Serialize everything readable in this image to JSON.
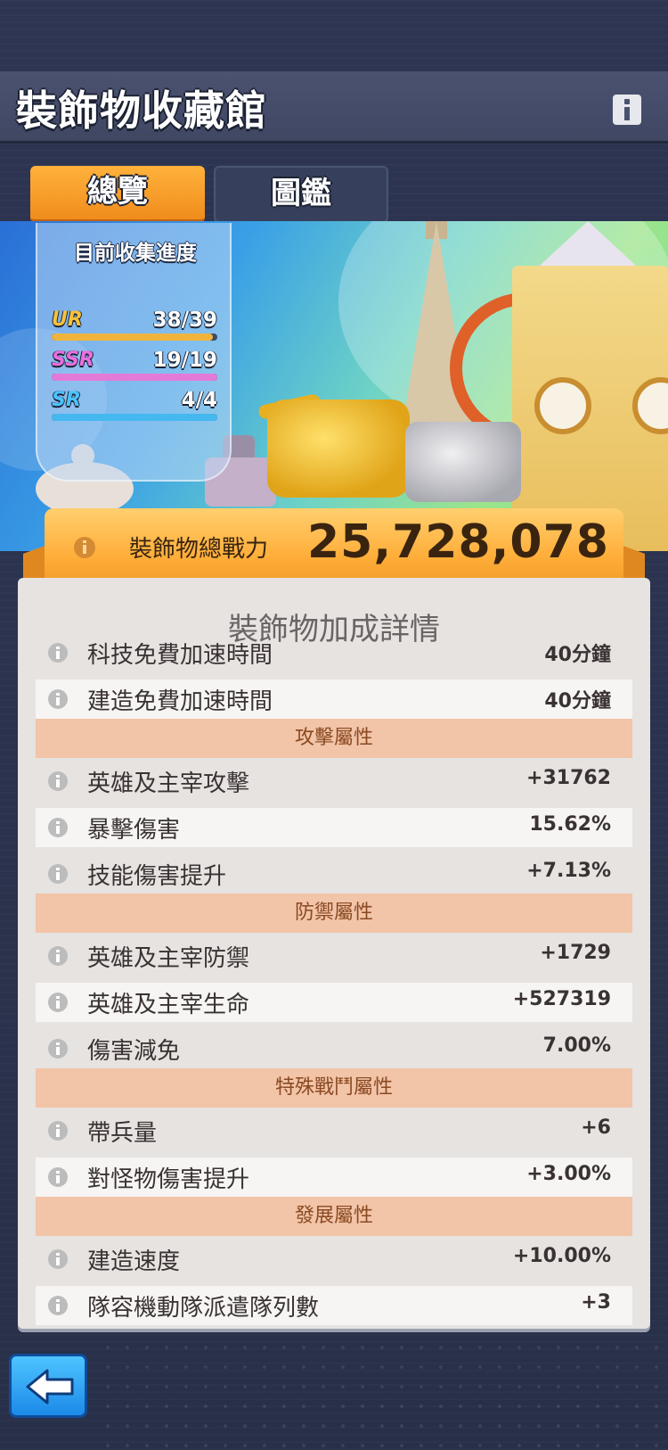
{
  "header": {
    "title": "裝飾物收藏館"
  },
  "tabs": [
    {
      "label": "總覽",
      "active": true
    },
    {
      "label": "圖鑑",
      "active": false
    }
  ],
  "progress": {
    "title": "目前收集進度",
    "items": [
      {
        "rarity": "UR",
        "count": "38/39",
        "fraction": 0.974,
        "color": "#f0b43c",
        "text_color": "#f5c23a"
      },
      {
        "rarity": "SSR",
        "count": "19/19",
        "fraction": 1.0,
        "color": "#e47ad8",
        "text_color": "#e86fe0"
      },
      {
        "rarity": "SR",
        "count": "4/4",
        "fraction": 1.0,
        "color": "#46b8f0",
        "text_color": "#4ac4ff"
      }
    ]
  },
  "power": {
    "label": "裝飾物總戰力",
    "value": "25,728,078"
  },
  "details": {
    "title": "裝飾物加成詳情",
    "rows": [
      {
        "label": "科技免費加速時間",
        "value": "40分鐘"
      },
      {
        "label": "建造免費加速時間",
        "value": "40分鐘"
      }
    ],
    "sections": [
      {
        "title": "攻擊屬性",
        "rows": [
          {
            "label": "英雄及主宰攻擊",
            "value": "+31762"
          },
          {
            "label": "暴擊傷害",
            "value": "15.62%"
          },
          {
            "label": "技能傷害提升",
            "value": "+7.13%"
          }
        ]
      },
      {
        "title": "防禦屬性",
        "rows": [
          {
            "label": "英雄及主宰防禦",
            "value": "+1729"
          },
          {
            "label": "英雄及主宰生命",
            "value": "+527319"
          },
          {
            "label": "傷害減免",
            "value": "7.00%"
          }
        ]
      },
      {
        "title": "特殊戰鬥屬性",
        "rows": [
          {
            "label": "帶兵量",
            "value": "+6"
          },
          {
            "label": "對怪物傷害提升",
            "value": "+3.00%"
          }
        ]
      },
      {
        "title": "發展屬性",
        "rows": [
          {
            "label": "建造速度",
            "value": "+10.00%"
          },
          {
            "label": "隊容機動隊派遣隊列數",
            "value": "+3"
          }
        ]
      }
    ]
  },
  "colors": {
    "accent": "#f08c1c",
    "section_bg": "#f2c4a8",
    "back_button": "#1c8ae8"
  },
  "icons": {
    "info": "info-icon",
    "back": "back-arrow-icon"
  }
}
